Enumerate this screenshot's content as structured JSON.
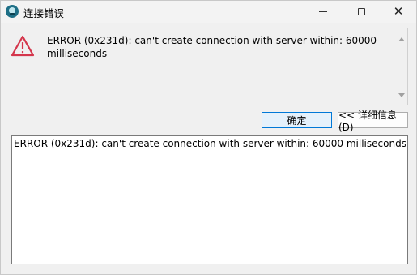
{
  "window": {
    "title": "连接错误",
    "controls": {
      "minimize_icon": "minimize-icon",
      "maximize_icon": "maximize-icon",
      "close_icon": "close-icon",
      "close_glyph": "✕"
    }
  },
  "message": {
    "icon": "warning-triangle-icon",
    "icon_color": "#d4364c",
    "text": "ERROR (0x231d): can't create connection with server within: 60000 milliseconds"
  },
  "buttons": {
    "ok_label": "确定",
    "details_label": "<< 详细信息(D)"
  },
  "details": {
    "text": "ERROR (0x231d): can't create connection with server within: 60000 milliseconds"
  }
}
